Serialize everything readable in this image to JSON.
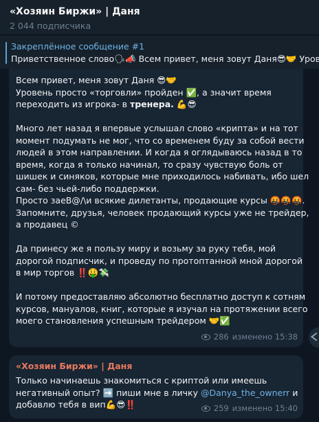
{
  "header": {
    "title": "«Хозяин Биржи» | Даня",
    "subscribers": "2 044 подписчика"
  },
  "pinned": {
    "title": "Закреплённое сообщение #1",
    "text": "Приветственное слово🗣📣 Всем привет, меня зовут Даня😎🤝 Уровень просто «торговли» пройден"
  },
  "post1": {
    "p1": [
      "Всем привет, меня зовут Даня 😎🤝",
      "Уровень просто  «торговли» пройден ✅, а значит время",
      "переходить из игрока- в "
    ],
    "p1_bold": "тренера.",
    "p1_tail": " 💪😎",
    "p2": [
      "Много лет назад я впервые услышал слово «крипта» и на тот",
      "момент подумать не мог, что со временем буду за собой  вести",
      "людей в этом направлении. И когда я оглядываюсь назад в то",
      "время, когда я только начинал, то сразу чувствую боль от",
      "шишек и синяков, которые мне приходилось набивать, ибо шел",
      "сам- без чьей-либо поддержки.",
      "Просто заеВ@/\\и всякие дилетанты, продающие курсы 🤬🤬🤬.",
      "Запомните, друзья, человек продающий курсы уже не трейдер,",
      "а продавец ©"
    ],
    "p3": [
      "Да принесу же я пользу миру и возьму за руку тебя, мой",
      "дорогой подписчик, и проведу по протоптанной мной дорогой",
      "в мир торгов ‼️🤑💸"
    ],
    "p4": [
      "И потому предоставляю абсолютно бесплатно доступ к сотням",
      "курсов, мануалов, книг, которые я изучал на протяжении всего",
      "моего становления успешным трейдером 🤝✅"
    ],
    "views": "286",
    "edited": "изменено 15:38"
  },
  "post2": {
    "author": "«Хозяин Биржи» | Даня",
    "line1": "Только начинаешь знакомиться с криптой или имеешь",
    "line2_a": "негативный опыт? ➡️ пиши мне в личку ",
    "mention": "@Danya_the_ownerr",
    "line2_b": " и",
    "line3": "добавлю тебя в вип💪😎‼️",
    "views": "259",
    "edited": "изменено 15:40"
  },
  "icons": {
    "views": "eye-icon",
    "share": "share-arrow-icon"
  },
  "colors": {
    "background": "#0e1621",
    "header": "#17212b",
    "bubble": "#182533",
    "accent": "#6fb4e6",
    "author": "#e8795f"
  }
}
